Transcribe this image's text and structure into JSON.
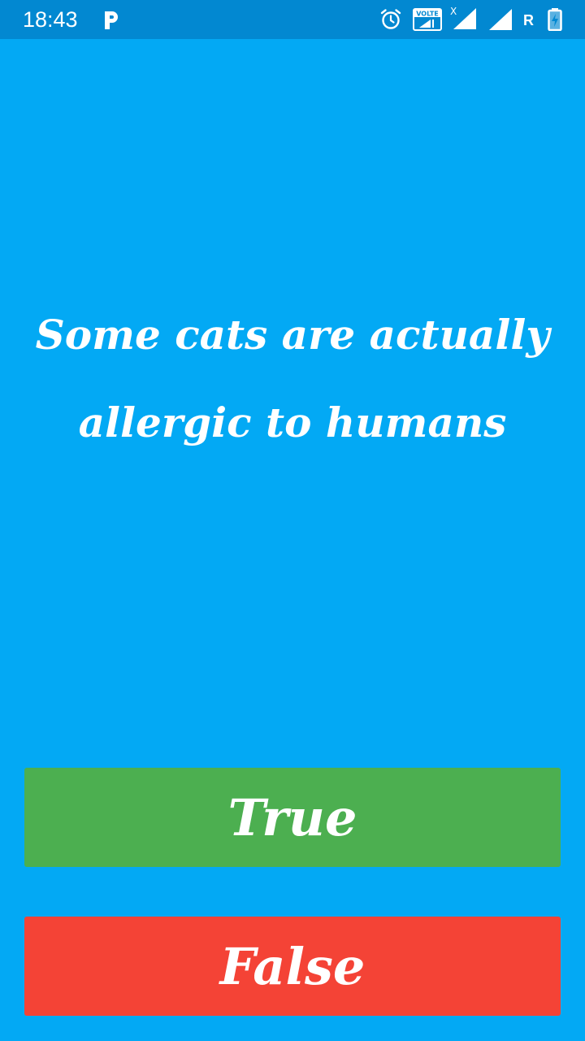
{
  "status_bar": {
    "time": "18:43",
    "icons": [
      "p-app-icon",
      "alarm-icon",
      "volte-icon",
      "signal-x-icon",
      "signal-icon",
      "battery-charging-icon"
    ],
    "volte_label": "VOLTE",
    "signal_badge": "X",
    "roaming_label": "R"
  },
  "quiz": {
    "question": "Some cats are actually allergic to humans",
    "true_label": "True",
    "false_label": "False"
  },
  "colors": {
    "background": "#03A9F4",
    "status_bar": "#0288D1",
    "true_button": "#4CAF50",
    "false_button": "#F44336",
    "text": "#FFFFFF"
  }
}
